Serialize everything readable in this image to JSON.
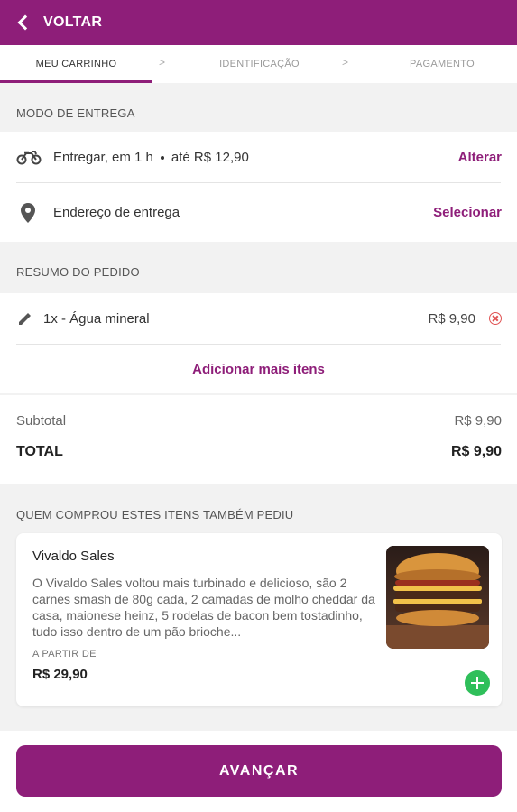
{
  "header": {
    "back_label": "VOLTAR"
  },
  "steps": {
    "items": [
      {
        "label": "MEU CARRINHO",
        "active": true
      },
      {
        "label": "IDENTIFICAÇÃO",
        "active": false
      },
      {
        "label": "PAGAMENTO",
        "active": false
      }
    ],
    "separator": ">"
  },
  "delivery": {
    "section_title": "MODO DE ENTREGA",
    "mode_text": "Entregar, em 1 h",
    "mode_price": "até R$ 12,90",
    "change_link": "Alterar",
    "address_label": "Endereço de entrega",
    "select_link": "Selecionar"
  },
  "order": {
    "section_title": "RESUMO DO PEDIDO",
    "items": [
      {
        "label": "1x - Água mineral",
        "price": "R$ 9,90"
      }
    ],
    "add_more": "Adicionar mais itens"
  },
  "totals": {
    "subtotal_label": "Subtotal",
    "subtotal_value": "R$ 9,90",
    "total_label": "TOTAL",
    "total_value": "R$ 9,90"
  },
  "recommendations": {
    "section_title": "QUEM COMPROU ESTES ITENS TAMBÉM PEDIU",
    "items": [
      {
        "name": "Vivaldo Sales",
        "description": "O Vivaldo Sales voltou mais turbinado e delicioso, são 2 carnes smash de 80g cada, 2 camadas de molho cheddar da casa, maionese heinz, 5 rodelas de bacon bem tostadinho, tudo isso dentro de um pão brioche...",
        "from_label": "A PARTIR DE",
        "price": "R$ 29,90"
      }
    ]
  },
  "footer": {
    "cta_label": "AVANÇAR"
  },
  "colors": {
    "brand": "#8e1e79",
    "add": "#2fbf5a",
    "remove": "#e05252"
  }
}
